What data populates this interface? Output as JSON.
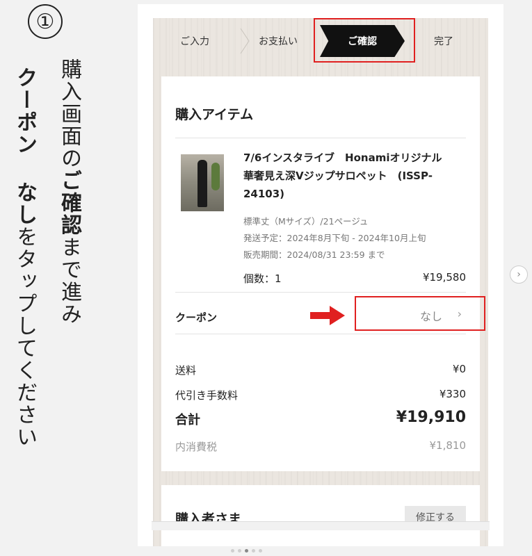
{
  "instruction": {
    "step_number": "①",
    "line1_pre": "購入画面の",
    "line1_bold": "ご確認",
    "line1_post": "まで進み",
    "line2_bold": "クーポン なし",
    "line2_post": "をタップしてください"
  },
  "checkout": {
    "steps": [
      "ご入力",
      "お支払い",
      "ご確認",
      "完了"
    ],
    "active_step": "ご確認",
    "section_title": "購入アイテム",
    "product": {
      "name": "7/6インスタライブ　Honamiオリジナル　華奢見え深Vジップサロペット　(ISSP-24103)",
      "variant": "標準丈（Mサイズ）/21ページュ",
      "ship_date": "発送予定：2024年8月下旬 - 2024年10月上旬",
      "sale_period": "販売期間：2024/08/31 23:59 まで",
      "qty": "個数：1",
      "price": "¥19,580"
    },
    "coupon": {
      "label": "クーポン",
      "value": "なし",
      "chevron": "›"
    },
    "summary": {
      "shipping_label": "送料",
      "shipping_value": "¥0",
      "cod_label": "代引き手数料",
      "cod_value": "¥330",
      "total_label": "合計",
      "total_value": "¥19,910",
      "tax_label": "内消費税",
      "tax_value": "¥1,810"
    },
    "buyer": {
      "title": "購入者さま",
      "edit_label": "修正する"
    }
  },
  "carousel": {
    "next_icon": "›",
    "dots": 5,
    "active_dot": 2
  },
  "colors": {
    "highlight": "#e02020",
    "active_step_bg": "#111111"
  }
}
